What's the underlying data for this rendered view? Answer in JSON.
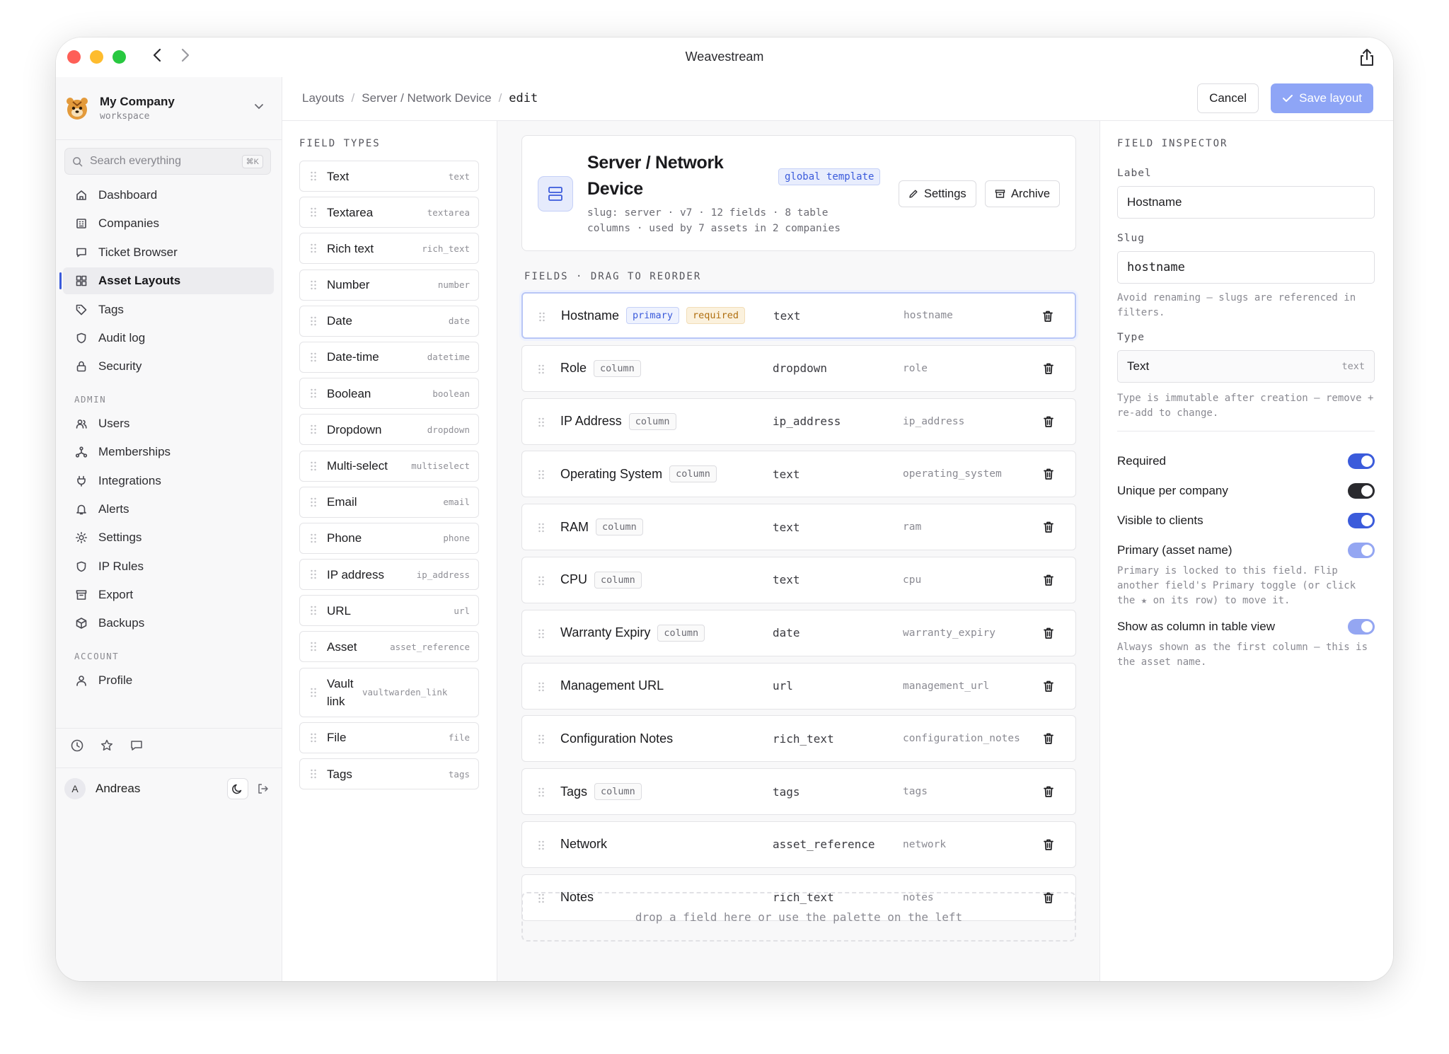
{
  "window": {
    "title": "Weavestream"
  },
  "workspace": {
    "name": "My Company",
    "sub": "workspace"
  },
  "search": {
    "placeholder": "Search everything",
    "shortcut": "⌘K"
  },
  "nav": {
    "main": [
      {
        "label": "Dashboard",
        "icon": "home-icon"
      },
      {
        "label": "Companies",
        "icon": "building-icon"
      },
      {
        "label": "Ticket Browser",
        "icon": "message-icon"
      },
      {
        "label": "Asset Layouts",
        "icon": "grid-icon",
        "active": true
      },
      {
        "label": "Tags",
        "icon": "tag-icon"
      },
      {
        "label": "Audit log",
        "icon": "shield-icon"
      },
      {
        "label": "Security",
        "icon": "lock-icon"
      }
    ],
    "admin_label": "ADMIN",
    "admin": [
      {
        "label": "Users",
        "icon": "users-icon"
      },
      {
        "label": "Memberships",
        "icon": "network-icon"
      },
      {
        "label": "Integrations",
        "icon": "plug-icon"
      },
      {
        "label": "Alerts",
        "icon": "bell-icon"
      },
      {
        "label": "Settings",
        "icon": "sun-icon"
      },
      {
        "label": "IP Rules",
        "icon": "shield-icon"
      },
      {
        "label": "Export",
        "icon": "archive-icon"
      },
      {
        "label": "Backups",
        "icon": "box-icon"
      }
    ],
    "account_label": "ACCOUNT",
    "account": [
      {
        "label": "Profile",
        "icon": "person-icon"
      }
    ]
  },
  "user": {
    "name": "Andreas",
    "initial": "A"
  },
  "breadcrumb": {
    "items": [
      "Layouts",
      "Server / Network Device"
    ],
    "current": "edit"
  },
  "actions": {
    "cancel": "Cancel",
    "save": "Save layout"
  },
  "palette": {
    "title": "FIELD TYPES",
    "items": [
      {
        "label": "Text",
        "slug": "text"
      },
      {
        "label": "Textarea",
        "slug": "textarea"
      },
      {
        "label": "Rich text",
        "slug": "rich_text"
      },
      {
        "label": "Number",
        "slug": "number"
      },
      {
        "label": "Date",
        "slug": "date"
      },
      {
        "label": "Date-time",
        "slug": "datetime"
      },
      {
        "label": "Boolean",
        "slug": "boolean"
      },
      {
        "label": "Dropdown",
        "slug": "dropdown"
      },
      {
        "label": "Multi-select",
        "slug": "multiselect"
      },
      {
        "label": "Email",
        "slug": "email"
      },
      {
        "label": "Phone",
        "slug": "phone"
      },
      {
        "label": "IP address",
        "slug": "ip_address"
      },
      {
        "label": "URL",
        "slug": "url"
      },
      {
        "label": "Asset",
        "slug": "asset_reference"
      },
      {
        "label": "Vault link",
        "slug": "vaultwarden_link"
      },
      {
        "label": "File",
        "slug": "file"
      },
      {
        "label": "Tags",
        "slug": "tags"
      }
    ]
  },
  "layout": {
    "title": "Server / Network Device",
    "badge": "global template",
    "meta": "slug: server · v7 · 12 fields · 8 table columns · used by 7 assets in 2 companies",
    "settings": "Settings",
    "archive": "Archive"
  },
  "fields": {
    "title": "FIELDS · DRAG TO REORDER",
    "primary_tag": "primary",
    "required_tag": "required",
    "column_tag": "column",
    "rows": [
      {
        "label": "Hostname",
        "type": "text",
        "slug": "hostname",
        "primary": true,
        "required": true,
        "column": false,
        "selected": true
      },
      {
        "label": "Role",
        "type": "dropdown",
        "slug": "role",
        "column": true
      },
      {
        "label": "IP Address",
        "type": "ip_address",
        "slug": "ip_address",
        "column": true
      },
      {
        "label": "Operating System",
        "type": "text",
        "slug": "operating_system",
        "column": true
      },
      {
        "label": "RAM",
        "type": "text",
        "slug": "ram",
        "column": true
      },
      {
        "label": "CPU",
        "type": "text",
        "slug": "cpu",
        "column": true
      },
      {
        "label": "Warranty Expiry",
        "type": "date",
        "slug": "warranty_expiry",
        "column": true
      },
      {
        "label": "Management URL",
        "type": "url",
        "slug": "management_url",
        "column": false
      },
      {
        "label": "Configuration Notes",
        "type": "rich_text",
        "slug": "configuration_notes",
        "column": false
      },
      {
        "label": "Tags",
        "type": "tags",
        "slug": "tags",
        "column": true
      },
      {
        "label": "Network",
        "type": "asset_reference",
        "slug": "network",
        "column": false
      },
      {
        "label": "Notes",
        "type": "rich_text",
        "slug": "notes",
        "column": false
      }
    ],
    "dropzone": "drop a field here or use the palette on the left"
  },
  "inspector": {
    "title": "FIELD INSPECTOR",
    "label_label": "Label",
    "label_value": "Hostname",
    "slug_label": "Slug",
    "slug_value": "hostname",
    "slug_hint": "Avoid renaming — slugs are referenced in filters.",
    "type_label": "Type",
    "type_value": "Text",
    "type_slug": "text",
    "type_hint": "Type is immutable after creation — remove + re-add to change.",
    "toggles": [
      {
        "label": "Required",
        "state": "on"
      },
      {
        "label": "Unique per company",
        "state": "off"
      },
      {
        "label": "Visible to clients",
        "state": "on"
      },
      {
        "label": "Primary (asset name)",
        "state": "locked"
      },
      {
        "label": "Show as column in table view",
        "state": "locked"
      }
    ],
    "primary_hint": "Primary is locked to this field. Flip another field's Primary toggle (or click the ★ on its row) to move it.",
    "column_hint": "Always shown as the first column — this is the asset name."
  },
  "colors": {
    "accent": "#3b5bdb",
    "save_button": "#8ea5f6"
  }
}
